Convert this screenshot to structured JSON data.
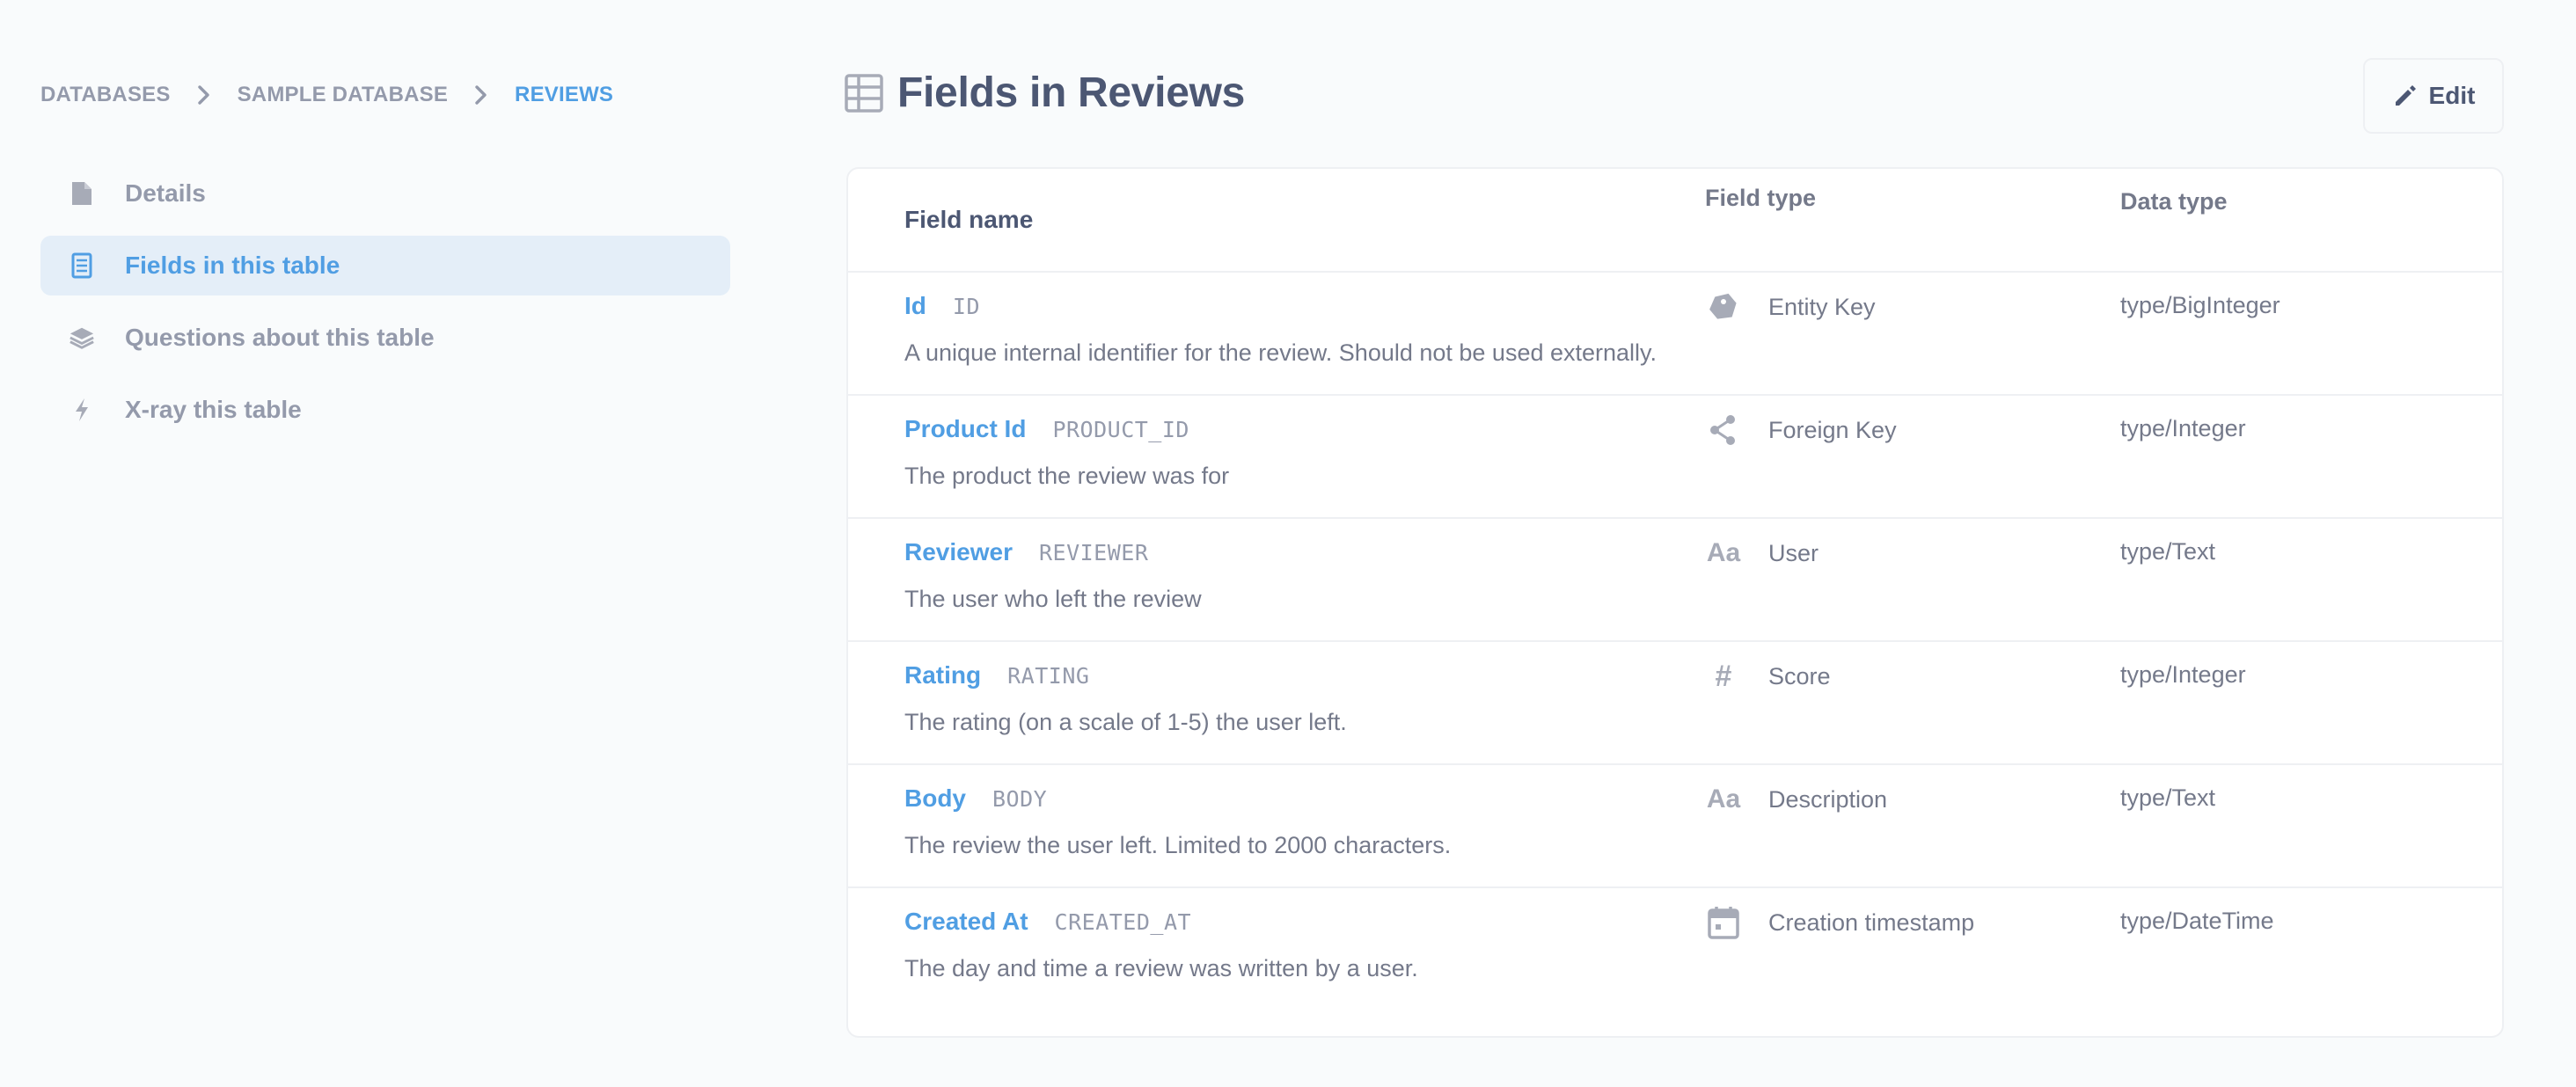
{
  "breadcrumbs": {
    "items": [
      "DATABASES",
      "SAMPLE DATABASE",
      "REVIEWS"
    ]
  },
  "sidebar": {
    "items": [
      {
        "label": "Details",
        "icon": "document-icon"
      },
      {
        "label": "Fields in this table",
        "icon": "list-icon"
      },
      {
        "label": "Questions about this table",
        "icon": "layers-icon"
      },
      {
        "label": "X-ray this table",
        "icon": "bolt-icon"
      }
    ]
  },
  "header": {
    "title": "Fields in Reviews",
    "icon": "table-icon",
    "edit_label": "Edit"
  },
  "table": {
    "columns": [
      "Field name",
      "Field type",
      "Data type"
    ],
    "rows": [
      {
        "name": "Id",
        "column": "ID",
        "description": "A unique internal identifier for the review. Should not be used externally.",
        "field_type": "Entity Key",
        "field_icon": "tag-icon",
        "data_type": "type/BigInteger"
      },
      {
        "name": "Product Id",
        "column": "PRODUCT_ID",
        "description": "The product the review was for",
        "field_type": "Foreign Key",
        "field_icon": "connections-icon",
        "data_type": "type/Integer"
      },
      {
        "name": "Reviewer",
        "column": "REVIEWER",
        "description": "The user who left the review",
        "field_type": "User",
        "field_icon": "text-icon",
        "data_type": "type/Text"
      },
      {
        "name": "Rating",
        "column": "RATING",
        "description": "The rating (on a scale of 1-5) the user left.",
        "field_type": "Score",
        "field_icon": "number-icon",
        "data_type": "type/Integer"
      },
      {
        "name": "Body",
        "column": "BODY",
        "description": "The review the user left. Limited to 2000 characters.",
        "field_type": "Description",
        "field_icon": "text-icon",
        "data_type": "type/Text"
      },
      {
        "name": "Created At",
        "column": "CREATED_AT",
        "description": "The day and time a review was written by a user.",
        "field_type": "Creation timestamp",
        "field_icon": "calendar-icon",
        "data_type": "type/DateTime"
      }
    ]
  },
  "colors": {
    "accent": "#509ee3",
    "text_dark": "#4c5773",
    "text_muted": "#949aab",
    "active_bg": "#e4eef8",
    "border": "#eef0f3"
  }
}
